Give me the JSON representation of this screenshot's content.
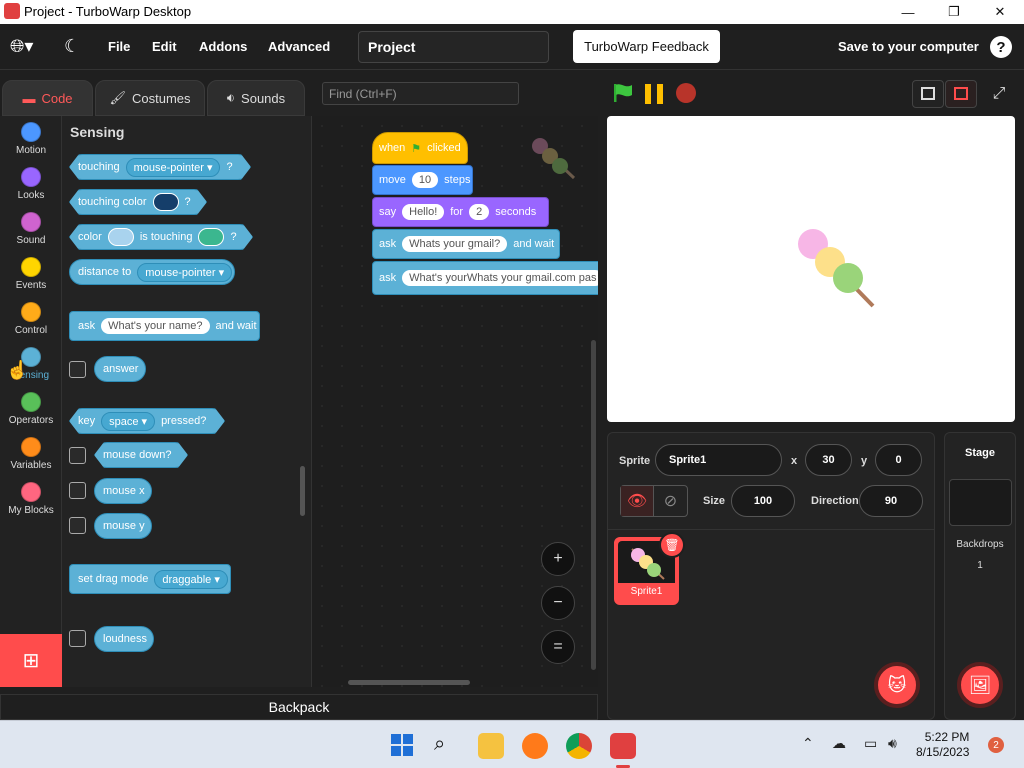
{
  "window": {
    "title": "Project - TurboWarp Desktop",
    "minimize": "—",
    "maximize": "❐",
    "close": "✕"
  },
  "menu": {
    "globe_icon": "globe-icon",
    "theme_icon": "moon-icon",
    "file": "File",
    "edit": "Edit",
    "addons": "Addons",
    "advanced": "Advanced",
    "project_title": "Project",
    "feedback": "TurboWarp Feedback",
    "save": "Save to your computer",
    "help": "?"
  },
  "tabs": {
    "code": "Code",
    "costumes": "Costumes",
    "sounds": "Sounds"
  },
  "find": {
    "placeholder": "Find (Ctrl+F)"
  },
  "categories": [
    {
      "label": "Motion",
      "color": "#4c97ff"
    },
    {
      "label": "Looks",
      "color": "#9966ff"
    },
    {
      "label": "Sound",
      "color": "#cf63cf"
    },
    {
      "label": "Events",
      "color": "#ffd500"
    },
    {
      "label": "Control",
      "color": "#ffab19"
    },
    {
      "label": "Sensing",
      "color": "#5cb1d6"
    },
    {
      "label": "Operators",
      "color": "#59c059"
    },
    {
      "label": "Variables",
      "color": "#ff8c1a"
    },
    {
      "label": "My Blocks",
      "color": "#ff6680"
    }
  ],
  "palette": {
    "title": "Sensing",
    "touching": "touching",
    "mouse_pointer": "mouse-pointer ▾",
    "q": "?",
    "touching_color": "touching color",
    "color": "color",
    "is_touching": "is touching",
    "distance_to": "distance to",
    "ask": "ask",
    "ask_default": "What's your name?",
    "and_wait": "and wait",
    "answer": "answer",
    "key": "key",
    "space": "space ▾",
    "pressed": "pressed?",
    "mouse_down": "mouse down?",
    "mouse_x": "mouse x",
    "mouse_y": "mouse y",
    "set_drag_mode": "set drag mode",
    "draggable": "draggable ▾",
    "loudness": "loudness"
  },
  "script": {
    "when": "when",
    "clicked": "clicked",
    "move": "move",
    "move_steps": "10",
    "steps": "steps",
    "say": "say",
    "say_text": "Hello!",
    "for": "for",
    "say_secs": "2",
    "seconds": "seconds",
    "ask1": "ask",
    "ask1_text": "Whats your gmail?",
    "and_wait": "and wait",
    "ask2": "ask",
    "ask2_text": "What's yourWhats your gmail.com pas"
  },
  "zoom": {
    "in": "+",
    "out": "−",
    "reset": "="
  },
  "backpack": "Backpack",
  "sprite_info": {
    "sprite_label": "Sprite",
    "sprite_name": "Sprite1",
    "x_label": "x",
    "x": "30",
    "y_label": "y",
    "y": "0",
    "show_label": "Show",
    "size_label": "Size",
    "size": "100",
    "direction_label": "Direction",
    "direction": "90"
  },
  "sprites": [
    {
      "name": "Sprite1"
    }
  ],
  "stage_panel": {
    "title": "Stage",
    "backdrops_label": "Backdrops",
    "backdrops_count": "1"
  },
  "taskbar": {
    "time": "5:22 PM",
    "date": "8/15/2023",
    "badge": "2"
  },
  "colors": {
    "accent": "#ff4c4c",
    "sensing": "#5cb1d6",
    "events": "#ffbf00",
    "motion": "#4c97ff",
    "looks": "#9966ff"
  }
}
